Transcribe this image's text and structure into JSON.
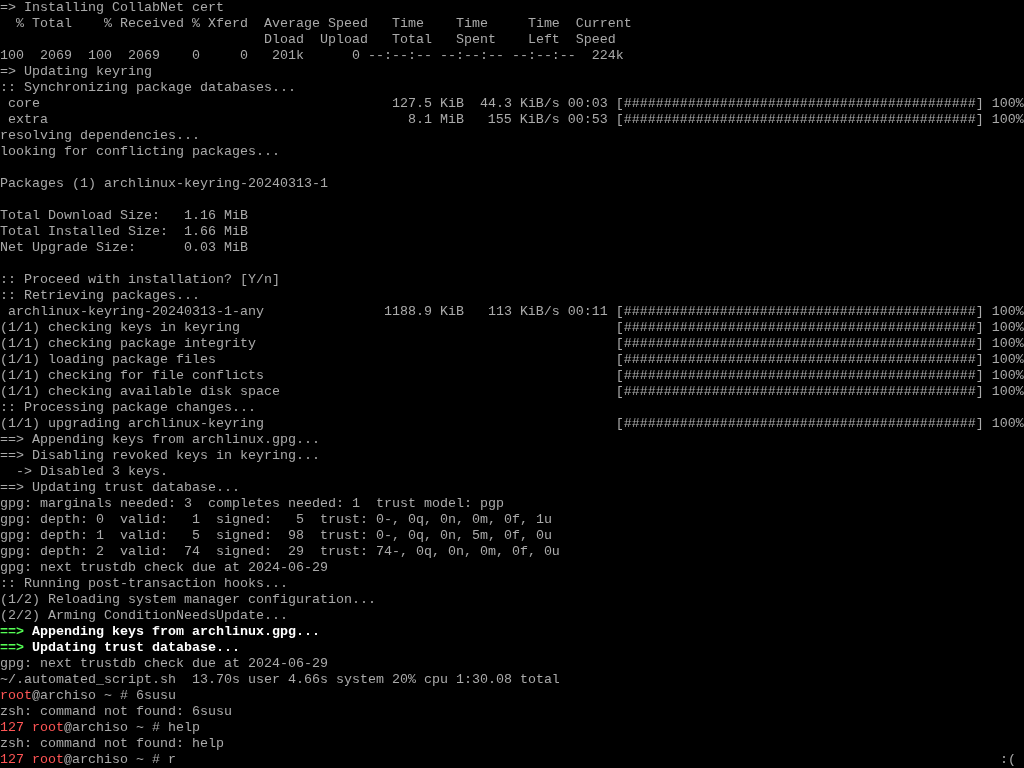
{
  "terminal": {
    "lines": [
      {
        "kind": "text",
        "segments": [
          {
            "kind": "plain",
            "text": "=> Installing CollabNet cert"
          }
        ]
      },
      {
        "kind": "text",
        "segments": [
          {
            "kind": "plain",
            "text": "  % Total    % Received % Xferd  Average Speed   Time    Time     Time  Current"
          }
        ]
      },
      {
        "kind": "text",
        "segments": [
          {
            "kind": "plain",
            "text": "                                 Dload  Upload   Total   Spent    Left  Speed"
          }
        ]
      },
      {
        "kind": "text",
        "segments": [
          {
            "kind": "plain",
            "text": "100  2069  100  2069    0     0   201k      0 --:--:-- --:--:-- --:--:--  224k"
          }
        ]
      },
      {
        "kind": "text",
        "segments": [
          {
            "kind": "plain",
            "text": "=> Updating keyring"
          }
        ]
      },
      {
        "kind": "text",
        "segments": [
          {
            "kind": "plain",
            "text": ":: Synchronizing package databases..."
          }
        ]
      },
      {
        "kind": "progress",
        "label": " core",
        "stats": "127.5 KiB  44.3 KiB/s 00:03",
        "bar": "[############################################]",
        "percent": "100%"
      },
      {
        "kind": "progress",
        "label": " extra",
        "stats": "8.1 MiB   155 KiB/s 00:53",
        "bar": "[############################################]",
        "percent": "100%"
      },
      {
        "kind": "text",
        "segments": [
          {
            "kind": "plain",
            "text": "resolving dependencies..."
          }
        ]
      },
      {
        "kind": "text",
        "segments": [
          {
            "kind": "plain",
            "text": "looking for conflicting packages..."
          }
        ]
      },
      {
        "kind": "blank"
      },
      {
        "kind": "text",
        "segments": [
          {
            "kind": "plain",
            "text": "Packages (1) archlinux-keyring-20240313-1"
          }
        ]
      },
      {
        "kind": "blank"
      },
      {
        "kind": "text",
        "segments": [
          {
            "kind": "plain",
            "text": "Total Download Size:   1.16 MiB"
          }
        ]
      },
      {
        "kind": "text",
        "segments": [
          {
            "kind": "plain",
            "text": "Total Installed Size:  1.66 MiB"
          }
        ]
      },
      {
        "kind": "text",
        "segments": [
          {
            "kind": "plain",
            "text": "Net Upgrade Size:      0.03 MiB"
          }
        ]
      },
      {
        "kind": "blank"
      },
      {
        "kind": "text",
        "segments": [
          {
            "kind": "plain",
            "text": ":: Proceed with installation? [Y/n]"
          }
        ]
      },
      {
        "kind": "text",
        "segments": [
          {
            "kind": "plain",
            "text": ":: Retrieving packages..."
          }
        ]
      },
      {
        "kind": "progress",
        "label": " archlinux-keyring-20240313-1-any",
        "stats": "1188.9 KiB   113 KiB/s 00:11",
        "bar": "[############################################]",
        "percent": "100%"
      },
      {
        "kind": "progress",
        "label": "(1/1) checking keys in keyring",
        "bar": "[############################################]",
        "percent": "100%"
      },
      {
        "kind": "progress",
        "label": "(1/1) checking package integrity",
        "bar": "[############################################]",
        "percent": "100%"
      },
      {
        "kind": "progress",
        "label": "(1/1) loading package files",
        "bar": "[############################################]",
        "percent": "100%"
      },
      {
        "kind": "progress",
        "label": "(1/1) checking for file conflicts",
        "bar": "[############################################]",
        "percent": "100%"
      },
      {
        "kind": "progress",
        "label": "(1/1) checking available disk space",
        "bar": "[############################################]",
        "percent": "100%"
      },
      {
        "kind": "text",
        "segments": [
          {
            "kind": "plain",
            "text": ":: Processing package changes..."
          }
        ]
      },
      {
        "kind": "progress",
        "label": "(1/1) upgrading archlinux-keyring",
        "bar": "[############################################]",
        "percent": "100%"
      },
      {
        "kind": "text",
        "segments": [
          {
            "kind": "plain",
            "text": "==> Appending keys from archlinux.gpg..."
          }
        ]
      },
      {
        "kind": "text",
        "segments": [
          {
            "kind": "plain",
            "text": "==> Disabling revoked keys in keyring..."
          }
        ]
      },
      {
        "kind": "text",
        "segments": [
          {
            "kind": "plain",
            "text": "  -> Disabled 3 keys."
          }
        ]
      },
      {
        "kind": "text",
        "segments": [
          {
            "kind": "plain",
            "text": "==> Updating trust database..."
          }
        ]
      },
      {
        "kind": "text",
        "segments": [
          {
            "kind": "plain",
            "text": "gpg: marginals needed: 3  completes needed: 1  trust model: pgp"
          }
        ]
      },
      {
        "kind": "text",
        "segments": [
          {
            "kind": "plain",
            "text": "gpg: depth: 0  valid:   1  signed:   5  trust: 0-, 0q, 0n, 0m, 0f, 1u"
          }
        ]
      },
      {
        "kind": "text",
        "segments": [
          {
            "kind": "plain",
            "text": "gpg: depth: 1  valid:   5  signed:  98  trust: 0-, 0q, 0n, 5m, 0f, 0u"
          }
        ]
      },
      {
        "kind": "text",
        "segments": [
          {
            "kind": "plain",
            "text": "gpg: depth: 2  valid:  74  signed:  29  trust: 74-, 0q, 0n, 0m, 0f, 0u"
          }
        ]
      },
      {
        "kind": "text",
        "segments": [
          {
            "kind": "plain",
            "text": "gpg: next trustdb check due at 2024-06-29"
          }
        ]
      },
      {
        "kind": "text",
        "segments": [
          {
            "kind": "plain",
            "text": ":: Running post-transaction hooks..."
          }
        ]
      },
      {
        "kind": "text",
        "segments": [
          {
            "kind": "plain",
            "text": "(1/2) Reloading system manager configuration..."
          }
        ]
      },
      {
        "kind": "text",
        "segments": [
          {
            "kind": "plain",
            "text": "(2/2) Arming ConditionNeedsUpdate..."
          }
        ]
      },
      {
        "kind": "text",
        "segments": [
          {
            "kind": "arrow",
            "text": "==>"
          },
          {
            "kind": "bold",
            "text": " Appending keys from archlinux.gpg..."
          }
        ]
      },
      {
        "kind": "text",
        "segments": [
          {
            "kind": "arrow",
            "text": "==>"
          },
          {
            "kind": "bold",
            "text": " Updating trust database..."
          }
        ]
      },
      {
        "kind": "text",
        "segments": [
          {
            "kind": "plain",
            "text": "gpg: next trustdb check due at 2024-06-29"
          }
        ]
      },
      {
        "kind": "text",
        "segments": [
          {
            "kind": "plain",
            "text": "~/.automated_script.sh  13.70s user 4.66s system 20% cpu 1:30.08 total"
          }
        ]
      },
      {
        "kind": "text",
        "segments": [
          {
            "kind": "red",
            "text": "root"
          },
          {
            "kind": "plain",
            "text": "@archiso ~ # 6susu"
          }
        ]
      },
      {
        "kind": "text",
        "segments": [
          {
            "kind": "plain",
            "text": "zsh: command not found: 6susu"
          }
        ]
      },
      {
        "kind": "text",
        "segments": [
          {
            "kind": "red",
            "text": "127 root"
          },
          {
            "kind": "plain",
            "text": "@archiso ~ # help"
          }
        ]
      },
      {
        "kind": "text",
        "segments": [
          {
            "kind": "plain",
            "text": "zsh: command not found: help"
          }
        ]
      },
      {
        "kind": "text",
        "segments": [
          {
            "kind": "red",
            "text": "127 root"
          },
          {
            "kind": "plain",
            "text": "@archiso ~ # r"
          }
        ],
        "right_text": ":("
      }
    ]
  }
}
